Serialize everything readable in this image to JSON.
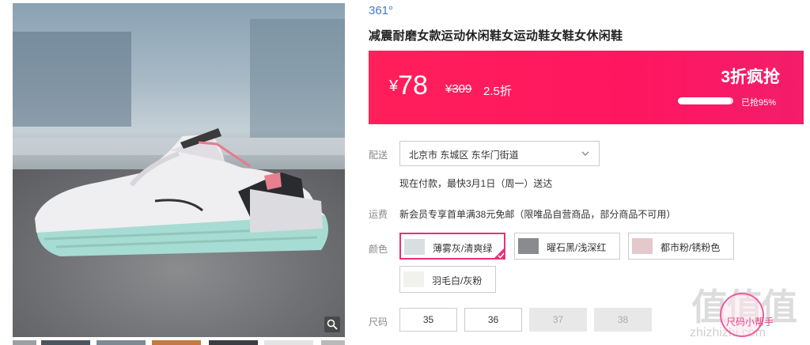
{
  "product": {
    "brand": "361°",
    "title": "减震耐磨女款运动休闲鞋女运动鞋女鞋女休闲鞋"
  },
  "promo": {
    "currency": "¥",
    "price": "78",
    "original_price": "¥309",
    "discount": "2.5折",
    "flash_label": "3折疯抢",
    "sold_percent": 95,
    "sold_text": "已抢95%"
  },
  "shipping": {
    "label": "配送",
    "address": "北京市 东城区 东华门街道",
    "delivery_note": "现在付款，最快3月1日（周一）送达"
  },
  "freight": {
    "label": "运费",
    "text": "新会员专享首单满38元免邮（限唯品自营商品，部分商品不可用）"
  },
  "colors": {
    "label": "颜色",
    "options": [
      {
        "name": "薄雾灰/清爽绿",
        "selected": true
      },
      {
        "name": "曜石黑/浅深红",
        "selected": false
      },
      {
        "name": "都市粉/锈粉色",
        "selected": false
      },
      {
        "name": "羽毛白/灰粉",
        "selected": false
      }
    ]
  },
  "sizes": {
    "label": "尺码",
    "options": [
      {
        "value": "35",
        "available": true
      },
      {
        "value": "36",
        "available": true
      },
      {
        "value": "37",
        "available": false
      },
      {
        "value": "38",
        "available": false
      }
    ]
  },
  "watermark": {
    "logo": "值值值",
    "site": "zhizhizhi.com",
    "helper": "尺码小帮手"
  },
  "theme": {
    "accent": "#ff1f5a",
    "brand_link": "#3d7ad6",
    "selected_border": "#e8307b"
  }
}
